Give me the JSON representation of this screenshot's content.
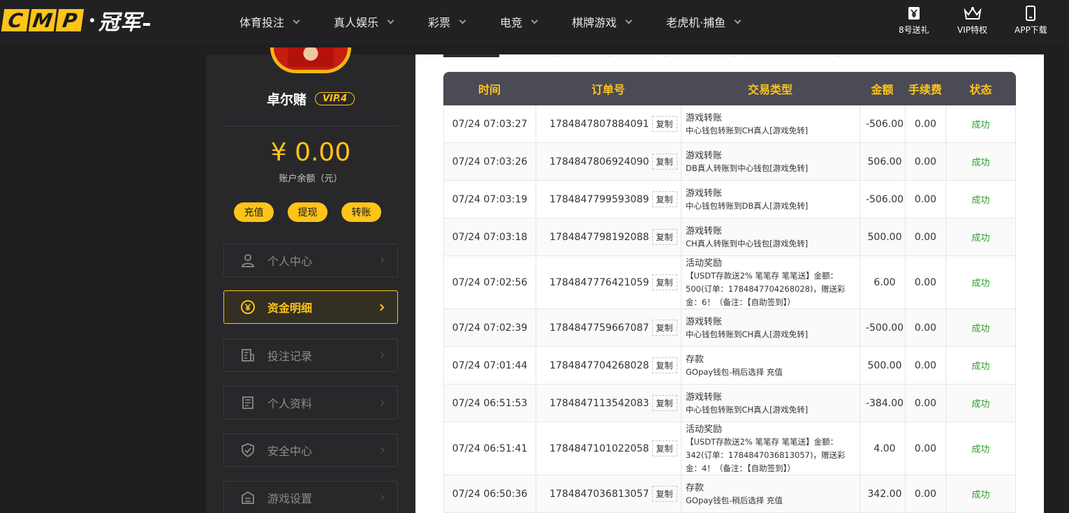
{
  "brand": {
    "letters": [
      "C",
      "M",
      "P"
    ],
    "cn": "冠军"
  },
  "nav": [
    {
      "label": "体育投注"
    },
    {
      "label": "真人娱乐"
    },
    {
      "label": "彩票"
    },
    {
      "label": "电竞"
    },
    {
      "label": "棋牌游戏"
    },
    {
      "label": "老虎机·捕鱼"
    }
  ],
  "top_right": [
    {
      "label": "8号送礼",
      "icon": "yen-ticket-icon"
    },
    {
      "label": "VIP特权",
      "icon": "crown-icon"
    },
    {
      "label": "APP下载",
      "icon": "phone-icon"
    }
  ],
  "user": {
    "name": "卓尔赌",
    "vip": "VIP.4"
  },
  "wallet": {
    "balance": "¥ 0.00",
    "balance_label": "账户余额（元）"
  },
  "actions": [
    {
      "label": "充值"
    },
    {
      "label": "提现"
    },
    {
      "label": "转账"
    }
  ],
  "menu": [
    {
      "label": "个人中心",
      "icon": "user-icon"
    },
    {
      "label": "资金明细",
      "icon": "yen-circle-icon",
      "active": true
    },
    {
      "label": "投注记录",
      "icon": "document-icon"
    },
    {
      "label": "个人资料",
      "icon": "profile-card-icon"
    },
    {
      "label": "安全中心",
      "icon": "shield-icon"
    },
    {
      "label": "游戏设置",
      "icon": "settings-box-icon"
    }
  ],
  "table": {
    "headers": [
      "时间",
      "订单号",
      "交易类型",
      "金额",
      "手续费",
      "状态"
    ],
    "copy_label": "复制",
    "rows": [
      {
        "time": "07/24 07:03:27",
        "order": "1784847807884091",
        "type": "游戏转账",
        "detail": "中心钱包转账到CH真人[游戏免转]",
        "amount": "-506.00",
        "fee": "0.00",
        "status": "成功"
      },
      {
        "time": "07/24 07:03:26",
        "order": "1784847806924090",
        "type": "游戏转账",
        "detail": "DB真人转账到中心钱包[游戏免转]",
        "amount": "506.00",
        "fee": "0.00",
        "status": "成功"
      },
      {
        "time": "07/24 07:03:19",
        "order": "1784847799593089",
        "type": "游戏转账",
        "detail": "中心钱包转账到DB真人[游戏免转]",
        "amount": "-506.00",
        "fee": "0.00",
        "status": "成功"
      },
      {
        "time": "07/24 07:03:18",
        "order": "1784847798192088",
        "type": "游戏转账",
        "detail": "CH真人转账到中心钱包[游戏免转]",
        "amount": "500.00",
        "fee": "0.00",
        "status": "成功"
      },
      {
        "time": "07/24 07:02:56",
        "order": "1784847776421059",
        "type": "活动奖励",
        "detail": "【USDT存款送2% 笔笔存 笔笔送】金额：500(订单：1784847704268028)，赠送彩金：6！（备注：【自助签到】）",
        "amount": "6.00",
        "fee": "0.00",
        "status": "成功"
      },
      {
        "time": "07/24 07:02:39",
        "order": "1784847759667087",
        "type": "游戏转账",
        "detail": "中心钱包转账到CH真人[游戏免转]",
        "amount": "-500.00",
        "fee": "0.00",
        "status": "成功"
      },
      {
        "time": "07/24 07:01:44",
        "order": "1784847704268028",
        "type": "存款",
        "detail": "GOpay钱包-稍后选择 充值",
        "amount": "500.00",
        "fee": "0.00",
        "status": "成功"
      },
      {
        "time": "07/24 06:51:53",
        "order": "1784847113542083",
        "type": "游戏转账",
        "detail": "中心钱包转账到CH真人[游戏免转]",
        "amount": "-384.00",
        "fee": "0.00",
        "status": "成功"
      },
      {
        "time": "07/24 06:51:41",
        "order": "1784847101022058",
        "type": "活动奖励",
        "detail": "【USDT存款送2% 笔笔存 笔笔送】金额：342(订单：1784847036813057)，赠送彩金：4！（备注：【自助签到】）",
        "amount": "4.00",
        "fee": "0.00",
        "status": "成功"
      },
      {
        "time": "07/24 06:50:36",
        "order": "1784847036813057",
        "type": "存款",
        "detail": "GOpay钱包-稍后选择 充值",
        "amount": "342.00",
        "fee": "0.00",
        "status": "成功"
      }
    ]
  },
  "colors": {
    "accent": "#ffc41a",
    "success": "#2b9e2b",
    "header_bg": "#4b4b55"
  }
}
